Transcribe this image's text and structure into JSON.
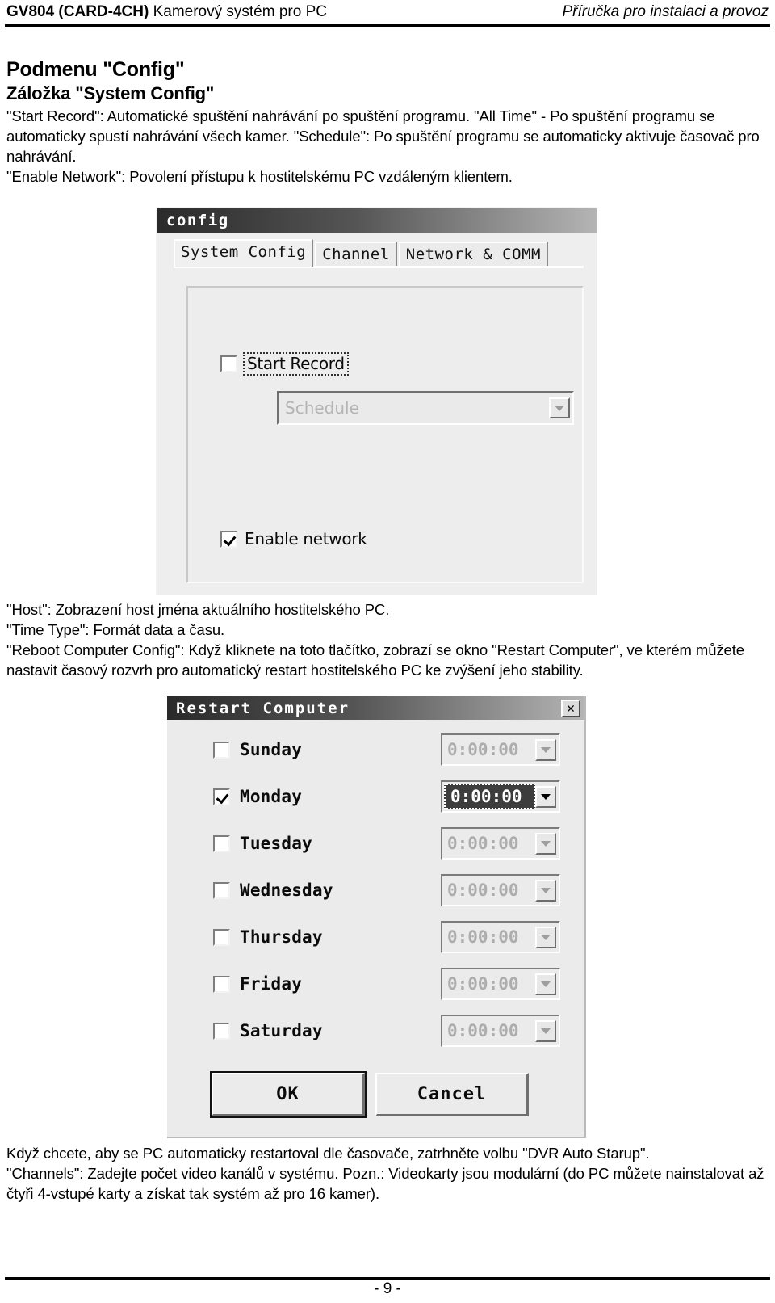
{
  "header": {
    "product_code": "GV804 (CARD-4CH)",
    "product_name": "Kamerový systém pro PC",
    "doc_subtitle": "Příručka pro instalaci a provoz"
  },
  "headings": {
    "h1": "Podmenu \"Config\"",
    "h2": "Záložka \"System Config\""
  },
  "paragraphs": {
    "intro": "\"Start Record\": Automatické spuštění nahrávání po spuštění programu. \"All Time\" - Po spuštění programu se automaticky spustí nahrávání všech kamer. \"Schedule\": Po spuštění programu se automaticky aktivuje časovač pro nahrávání.\n\"Enable Network\": Povolení přístupu k hostitelskému PC vzdáleným klientem.",
    "middle": "\"Host\": Zobrazení host jména aktuálního hostitelského PC.\n\"Time Type\": Formát data a času.\n\"Reboot Computer Config\": Když kliknete na toto tlačítko, zobrazí se okno \"Restart Computer\", ve kterém můžete nastavit časový rozvrh pro automatický restart hostitelského PC ke zvýšení jeho stability.",
    "bottom": "Když chcete, aby se PC automaticky restartoval dle časovače, zatrhněte volbu \"DVR Auto Starup\".\n\"Channels\": Zadejte počet video kanálů v systému. Pozn.: Videokarty jsou modulární (do PC můžete nainstalovat až čtyři 4-vstupé karty a získat tak systém až pro 16 kamer)."
  },
  "config_window": {
    "title": "config",
    "tabs": [
      {
        "label": "System Config",
        "active": true
      },
      {
        "label": "Channel",
        "active": false
      },
      {
        "label": "Network & COMM",
        "active": false
      }
    ],
    "start_record": {
      "label": "Start Record",
      "checked": false
    },
    "schedule_combo": {
      "value": "Schedule",
      "enabled": false
    },
    "enable_network": {
      "label": "Enable network",
      "checked": true
    }
  },
  "restart_window": {
    "title": "Restart Computer",
    "close_glyph": "✕",
    "days": [
      {
        "label": "Sunday",
        "checked": false,
        "time": "0:00:00",
        "active": false
      },
      {
        "label": "Monday",
        "checked": true,
        "time": "0:00:00",
        "active": true
      },
      {
        "label": "Tuesday",
        "checked": false,
        "time": "0:00:00",
        "active": false
      },
      {
        "label": "Wednesday",
        "checked": false,
        "time": "0:00:00",
        "active": false
      },
      {
        "label": "Thursday",
        "checked": false,
        "time": "0:00:00",
        "active": false
      },
      {
        "label": "Friday",
        "checked": false,
        "time": "0:00:00",
        "active": false
      },
      {
        "label": "Saturday",
        "checked": false,
        "time": "0:00:00",
        "active": false
      }
    ],
    "ok_label": "OK",
    "cancel_label": "Cancel"
  },
  "footer": {
    "page_number": "- 9 -"
  }
}
